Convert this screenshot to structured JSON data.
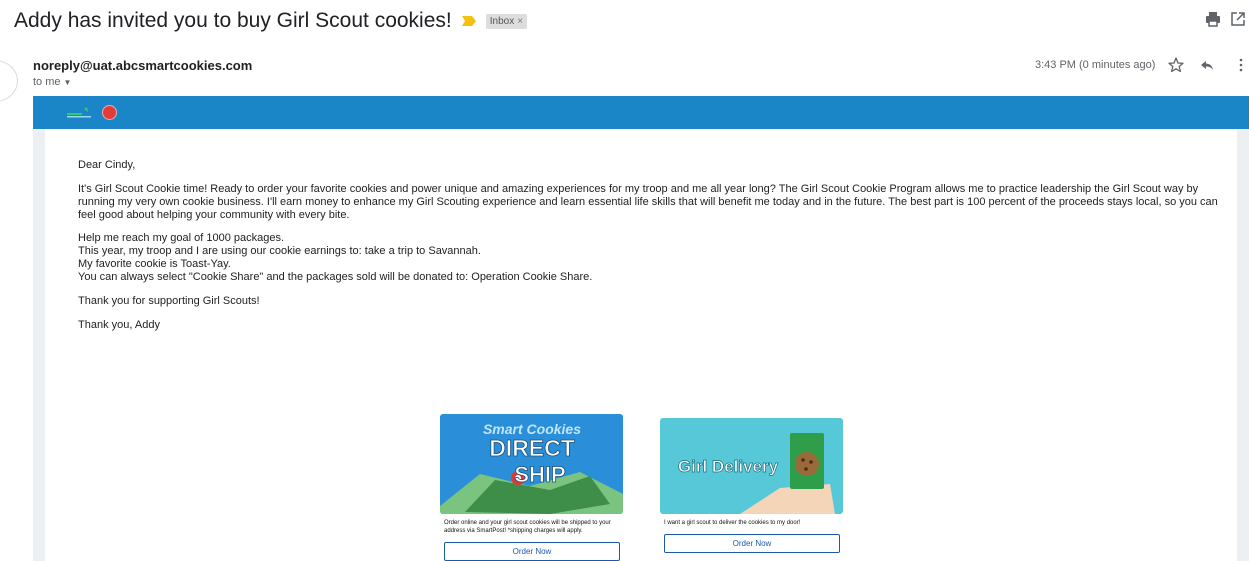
{
  "email": {
    "subject": "Addy has invited you to buy Girl Scout cookies!",
    "label_chip": "Inbox",
    "label_chip_remove": "×",
    "sender": "noreply@uat.abcsmartcookies.com",
    "recipient": "to me",
    "timestamp": "3:43 PM (0 minutes ago)"
  },
  "icons": {
    "importance": "importance-marker-icon",
    "print": "print-icon",
    "open_new_window": "open-in-new-window-icon",
    "star": "star-icon",
    "reply": "reply-icon",
    "more": "more-vertical-icon"
  },
  "colors": {
    "header_bar": "#1a86c7",
    "importance": "#f4c20d",
    "button_border": "#1a5aa8",
    "abc_logo": "#e23d3a"
  },
  "letter": {
    "greeting": "Dear Cindy,",
    "paragraph_1": "It's Girl Scout Cookie time! Ready to order your favorite cookies and power unique and amazing experiences for my troop and me all year long? The Girl Scout Cookie Program allows me to practice leadership the Girl Scout way by running my very own cookie business. I'll earn money to enhance my Girl Scouting experience and learn essential life skills that will benefit me today and in the future. The best part is 100 percent of the proceeds stays local, so you can feel good about helping your community with every bite.",
    "goal_line": "Help me reach my goal of 1000 packages.",
    "earnings_line": "This year, my troop and I are using our cookie earnings to: take a trip to Savannah.",
    "favorite_line": "My favorite cookie is Toast-Yay.",
    "share_line": "You can always select \"Cookie Share\" and the packages sold will be donated to: Operation Cookie Share.",
    "thanks_line": "Thank you for supporting Girl Scouts!",
    "signoff": "Thank you, Addy"
  },
  "promos": {
    "direct_ship": {
      "image_brand": "Smart Cookies",
      "image_line_1": "DIRECT",
      "image_line_2": "SHIP",
      "description": "Order online and your girl scout cookies will be shipped to your address via SmartPost! *shipping charges will apply.",
      "button": "Order Now"
    },
    "girl_delivery": {
      "image_title": "Girl Delivery",
      "description": "I want a girl scout to deliver the cookies to my door!",
      "button": "Order Now"
    }
  }
}
